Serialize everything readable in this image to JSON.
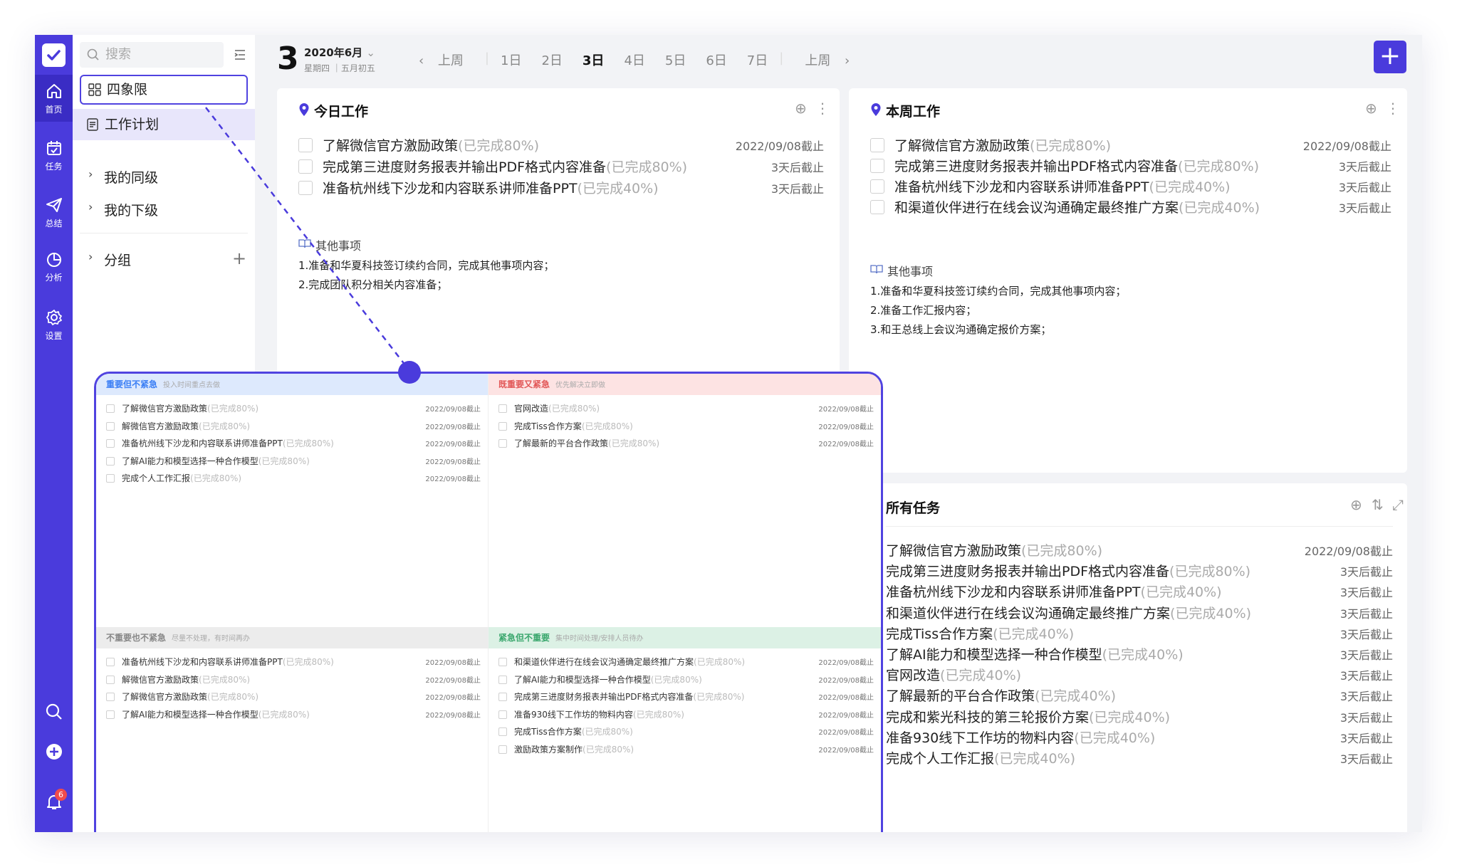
{
  "sidebar": {
    "search_placeholder": "搜索",
    "quadrant": "四象限",
    "plan": "工作计划",
    "peers": "我的同级",
    "subordinates": "我的下级",
    "groups": "分组"
  },
  "rail": {
    "home": "首页",
    "tasks": "任务",
    "summary": "总结",
    "analysis": "分析",
    "settings": "设置",
    "notif_count": "6"
  },
  "topbar": {
    "day": "3",
    "month": "2020年6月",
    "sub": "星期四 ｜五月初五",
    "prev": "上周",
    "next": "上周",
    "days": [
      "1日",
      "2日",
      "3日",
      "4日",
      "5日",
      "6日",
      "7日"
    ],
    "selected_day": "3日"
  },
  "today": {
    "title": "今日工作",
    "tasks": [
      {
        "name": "了解微信官方激励政策",
        "prog": "(已完成80%)",
        "due": "2022/09/08截止"
      },
      {
        "name": "完成第三进度财务报表并输出PDF格式内容准备",
        "prog": "(已完成80%)",
        "due": "3天后截止"
      },
      {
        "name": "准备杭州线下沙龙和内容联系讲师准备PPT",
        "prog": "(已完成40%)",
        "due": "3天后截止"
      }
    ],
    "other_title": "其他事项",
    "other": [
      "1.准备和华夏科技签订续约合同，完成其他事项内容；",
      "2.完成团队积分相关内容准备；"
    ]
  },
  "week": {
    "title": "本周工作",
    "tasks": [
      {
        "name": "了解微信官方激励政策",
        "prog": "(已完成80%)",
        "due": "2022/09/08截止"
      },
      {
        "name": "完成第三进度财务报表并输出PDF格式内容准备",
        "prog": "(已完成80%)",
        "due": "3天后截止"
      },
      {
        "name": "准备杭州线下沙龙和内容联系讲师准备PPT",
        "prog": "(已完成40%)",
        "due": "3天后截止"
      },
      {
        "name": "和渠道伙伴进行在线会议沟通确定最终推广方案",
        "prog": "(已完成40%)",
        "due": "3天后截止"
      }
    ],
    "other_title": "其他事项",
    "other": [
      "1.准备和华夏科技签订续约合同，完成其他事项内容；",
      "2.准备工作汇报内容；",
      "3.和王总线上会议沟通确定报价方案；"
    ]
  },
  "all": {
    "title": "所有任务",
    "tasks": [
      {
        "name": "了解微信官方激励政策",
        "prog": "(已完成80%)",
        "due": "2022/09/08截止"
      },
      {
        "name": "完成第三进度财务报表并输出PDF格式内容准备",
        "prog": "(已完成80%)",
        "due": "3天后截止"
      },
      {
        "name": "准备杭州线下沙龙和内容联系讲师准备PPT",
        "prog": "(已完成40%)",
        "due": "3天后截止"
      },
      {
        "name": "和渠道伙伴进行在线会议沟通确定最终推广方案",
        "prog": "(已完成40%)",
        "due": "3天后截止"
      },
      {
        "name": "完成Tiss合作方案",
        "prog": "(已完成40%)",
        "due": "3天后截止"
      },
      {
        "name": "了解AI能力和模型选择一种合作模型",
        "prog": "(已完成40%)",
        "due": "3天后截止"
      },
      {
        "name": "官网改造",
        "prog": "(已完成40%)",
        "due": "3天后截止"
      },
      {
        "name": "了解最新的平台合作政策",
        "prog": "(已完成40%)",
        "due": "3天后截止"
      },
      {
        "name": "完成和紫光科技的第三轮报价方案",
        "prog": "(已完成40%)",
        "due": "3天后截止"
      },
      {
        "name": "准备930线下工作坊的物料内容",
        "prog": "(已完成40%)",
        "due": "3天后截止"
      },
      {
        "name": "完成个人工作汇报",
        "prog": "(已完成40%)",
        "due": "3天后截止"
      }
    ]
  },
  "quadrants": [
    {
      "title": "重要但不紧急",
      "sub": "投入时间重点去做",
      "color": "#3b7ff5",
      "bg": "#dde9fd",
      "tasks": [
        {
          "name": "了解微信官方激励政策",
          "prog": "(已完成80%)",
          "due": "2022/09/08截止"
        },
        {
          "name": "解微信官方激励政策",
          "prog": "(已完成80%)",
          "due": "2022/09/08截止"
        },
        {
          "name": "准备杭州线下沙龙和内容联系讲师准备PPT",
          "prog": "(已完成80%)",
          "due": "2022/09/08截止"
        },
        {
          "name": "了解AI能力和模型选择一种合作模型",
          "prog": "(已完成80%)",
          "due": "2022/09/08截止"
        },
        {
          "name": "完成个人工作汇报",
          "prog": "(已完成80%)",
          "due": "2022/09/08截止"
        }
      ]
    },
    {
      "title": "既重要又紧急",
      "sub": "优先解决立即做",
      "color": "#e25757",
      "bg": "#fde3e3",
      "tasks": [
        {
          "name": "官网改造",
          "prog": "(已完成80%)",
          "due": "2022/09/08截止"
        },
        {
          "name": "完成Tiss合作方案",
          "prog": "(已完成80%)",
          "due": "2022/09/08截止"
        },
        {
          "name": "了解最新的平台合作政策",
          "prog": "(已完成80%)",
          "due": "2022/09/08截止"
        }
      ]
    },
    {
      "title": "不重要也不紧急",
      "sub": "尽量不处理，有时间再办",
      "color": "#888888",
      "bg": "#ececec",
      "tasks": [
        {
          "name": "准备杭州线下沙龙和内容联系讲师准备PPT",
          "prog": "(已完成80%)",
          "due": "2022/09/08截止"
        },
        {
          "name": "解微信官方激励政策",
          "prog": "(已完成80%)",
          "due": "2022/09/08截止"
        },
        {
          "name": "了解微信官方激励政策",
          "prog": "(已完成80%)",
          "due": "2022/09/08截止"
        },
        {
          "name": "了解AI能力和模型选择一种合作模型",
          "prog": "(已完成80%)",
          "due": "2022/09/08截止"
        }
      ]
    },
    {
      "title": "紧急但不重要",
      "sub": "集中时间处理/安排人员待办",
      "color": "#3aa76d",
      "bg": "#dcf1e5",
      "tasks": [
        {
          "name": "和渠道伙伴进行在线会议沟通确定最终推广方案",
          "prog": "(已完成80%)",
          "due": "2022/09/08截止"
        },
        {
          "name": "了解AI能力和模型选择一种合作模型",
          "prog": "(已完成80%)",
          "due": "2022/09/08截止"
        },
        {
          "name": "完成第三进度财务报表并输出PDF格式内容准备",
          "prog": "(已完成80%)",
          "due": "2022/09/08截止"
        },
        {
          "name": "准备930线下工作坊的物料内容",
          "prog": "(已完成80%)",
          "due": "2022/09/08截止"
        },
        {
          "name": "完成Tiss合作方案",
          "prog": "(已完成80%)",
          "due": "2022/09/08截止"
        },
        {
          "name": "激励政策方案制作",
          "prog": "(已完成80%)",
          "due": "2022/09/08截止"
        }
      ]
    }
  ],
  "colors": {
    "accent": "#4a3bdc",
    "muted": "#aaaaaa"
  }
}
